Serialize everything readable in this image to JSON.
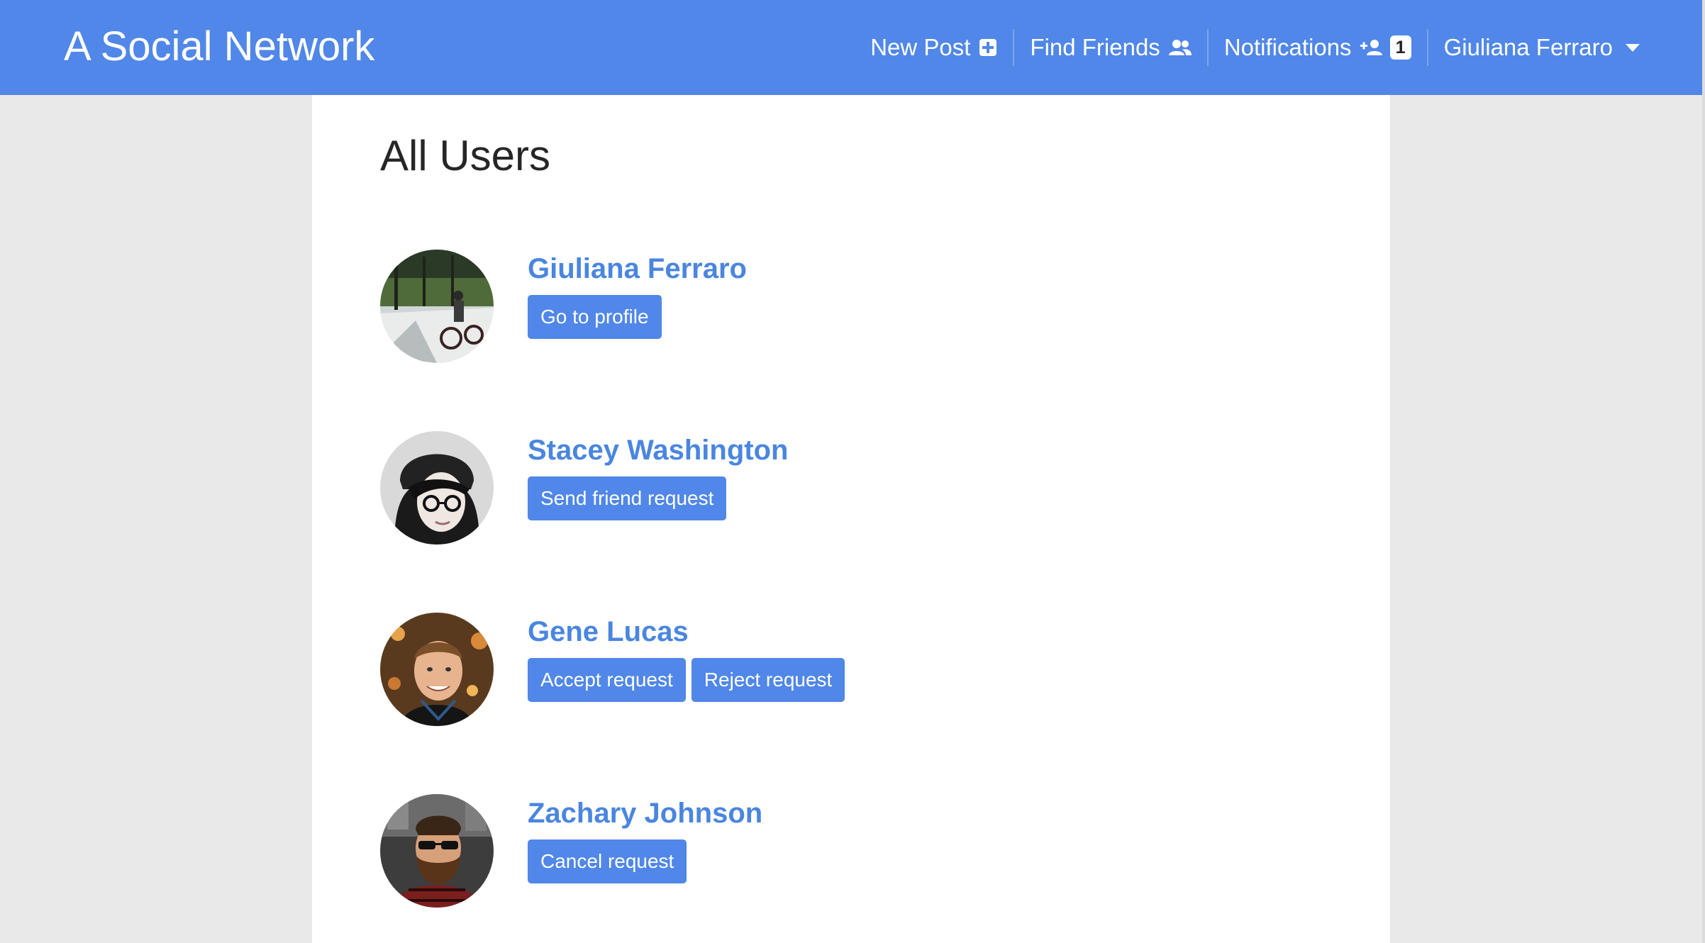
{
  "navbar": {
    "brand": "A Social Network",
    "new_post": "New Post",
    "find_friends": "Find Friends",
    "notifications": "Notifications",
    "notification_count": "1",
    "user_menu": "Giuliana Ferraro",
    "color": "#5087e8"
  },
  "page": {
    "title": "All Users"
  },
  "users": [
    {
      "name": "Giuliana Ferraro",
      "buttons": [
        "Go to profile"
      ]
    },
    {
      "name": "Stacey Washington",
      "buttons": [
        "Send friend request"
      ]
    },
    {
      "name": "Gene Lucas",
      "buttons": [
        "Accept request",
        "Reject request"
      ]
    },
    {
      "name": "Zachary Johnson",
      "buttons": [
        "Cancel request"
      ]
    }
  ]
}
